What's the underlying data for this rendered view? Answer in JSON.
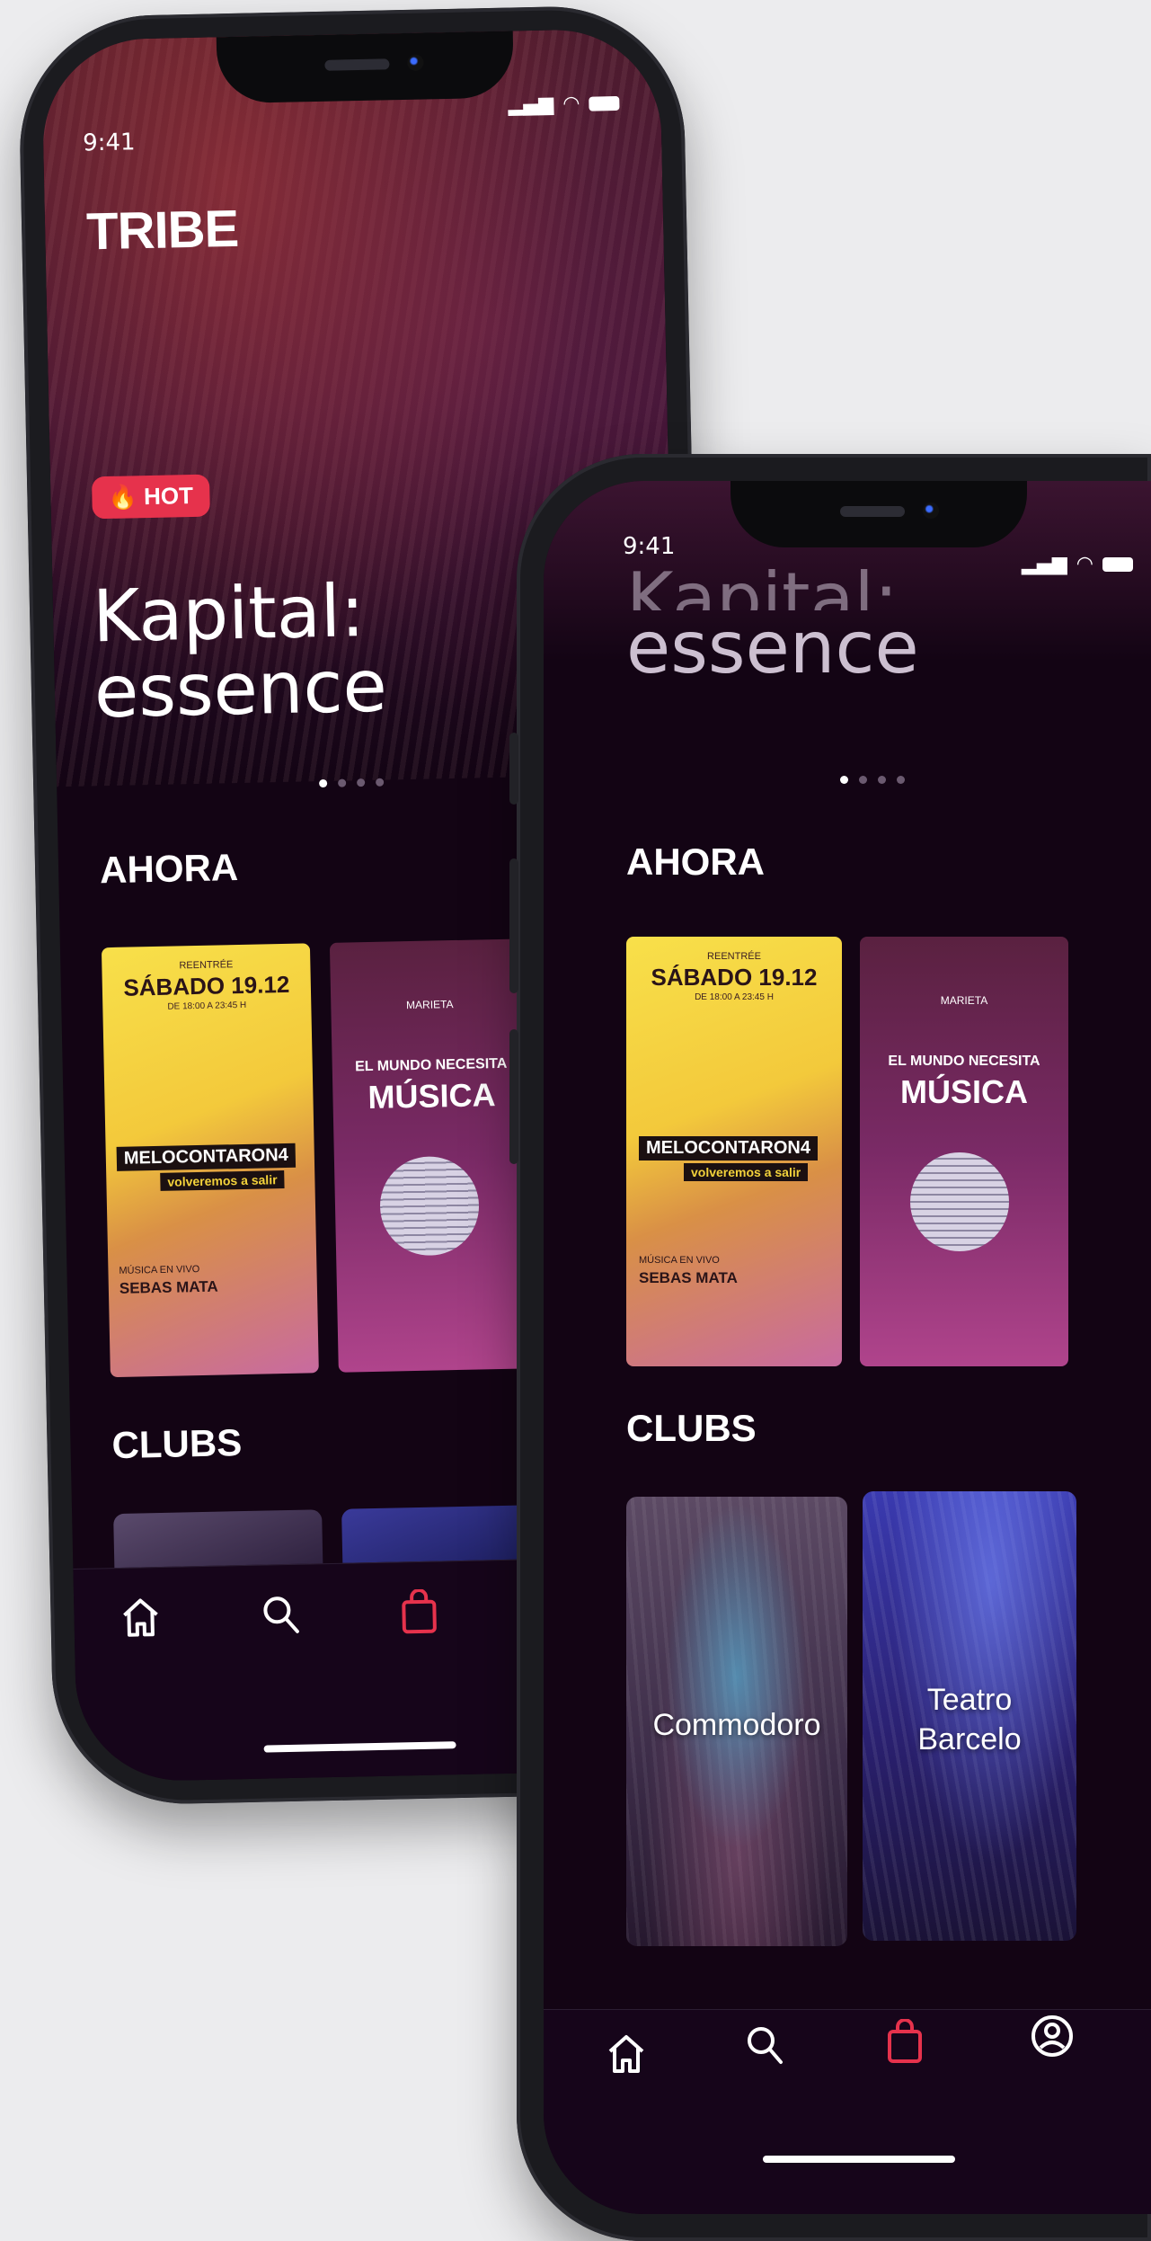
{
  "status": {
    "time": "9:41"
  },
  "app": {
    "logo": "TRIBE"
  },
  "hero": {
    "badge": "HOT",
    "title_line1": "Kapital:",
    "title_line2": "essence",
    "dots": 4,
    "active_dot": 0
  },
  "sections": {
    "now": "AHORA",
    "clubs": "CLUBS"
  },
  "events": [
    {
      "top": "REENTRÉE",
      "date": "SÁBADO 19.12",
      "hours": "DE 18:00 A 23:45 H",
      "name": "MELOCONTARON4",
      "subtitle": "volveremos a salir",
      "live_label": "MÚSICA EN VIVO",
      "artist": "SEBAS MATA"
    },
    {
      "brand": "MARIETA",
      "line1": "EL MUNDO NECESITA",
      "line2": "MÚSICA"
    }
  ],
  "clubs": [
    {
      "name": "Commodoro"
    },
    {
      "name_line1": "Teatro",
      "name_line2": "Barcelo"
    }
  ],
  "tabs": [
    "home",
    "search",
    "bag",
    "profile"
  ],
  "colors": {
    "accent": "#e6324c",
    "background": "#130414"
  }
}
